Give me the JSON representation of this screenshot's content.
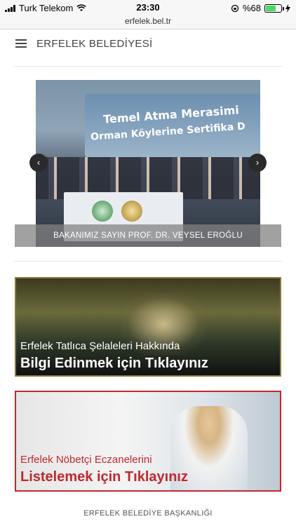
{
  "status": {
    "carrier": "Turk Telekom",
    "time": "23:30",
    "battery": "%68",
    "battery_level": 0.68
  },
  "browser": {
    "url": "erfelek.bel.tr"
  },
  "header": {
    "title": "ERFELEK BELEDİYESİ"
  },
  "carousel": {
    "banner_line1": "Temel Atma Merasimi",
    "banner_line2": "Orman Köylerine Sertifika D",
    "caption": "BAKANIMIZ SAYIN PROF. DR. VEYSEL EROĞLU",
    "prev": "‹",
    "next": "›"
  },
  "cards": [
    {
      "line1": "Erfelek Tatlıca Şelaleleri Hakkında",
      "line2": "Bilgi Edinmek için Tıklayınız"
    },
    {
      "line1": "Erfelek Nöbetçi Eczanelerini",
      "line2": "Listelemek için Tıklayınız"
    }
  ],
  "footer": {
    "text": "ERFELEK BELEDİYE BAŞKANLIĞI"
  }
}
